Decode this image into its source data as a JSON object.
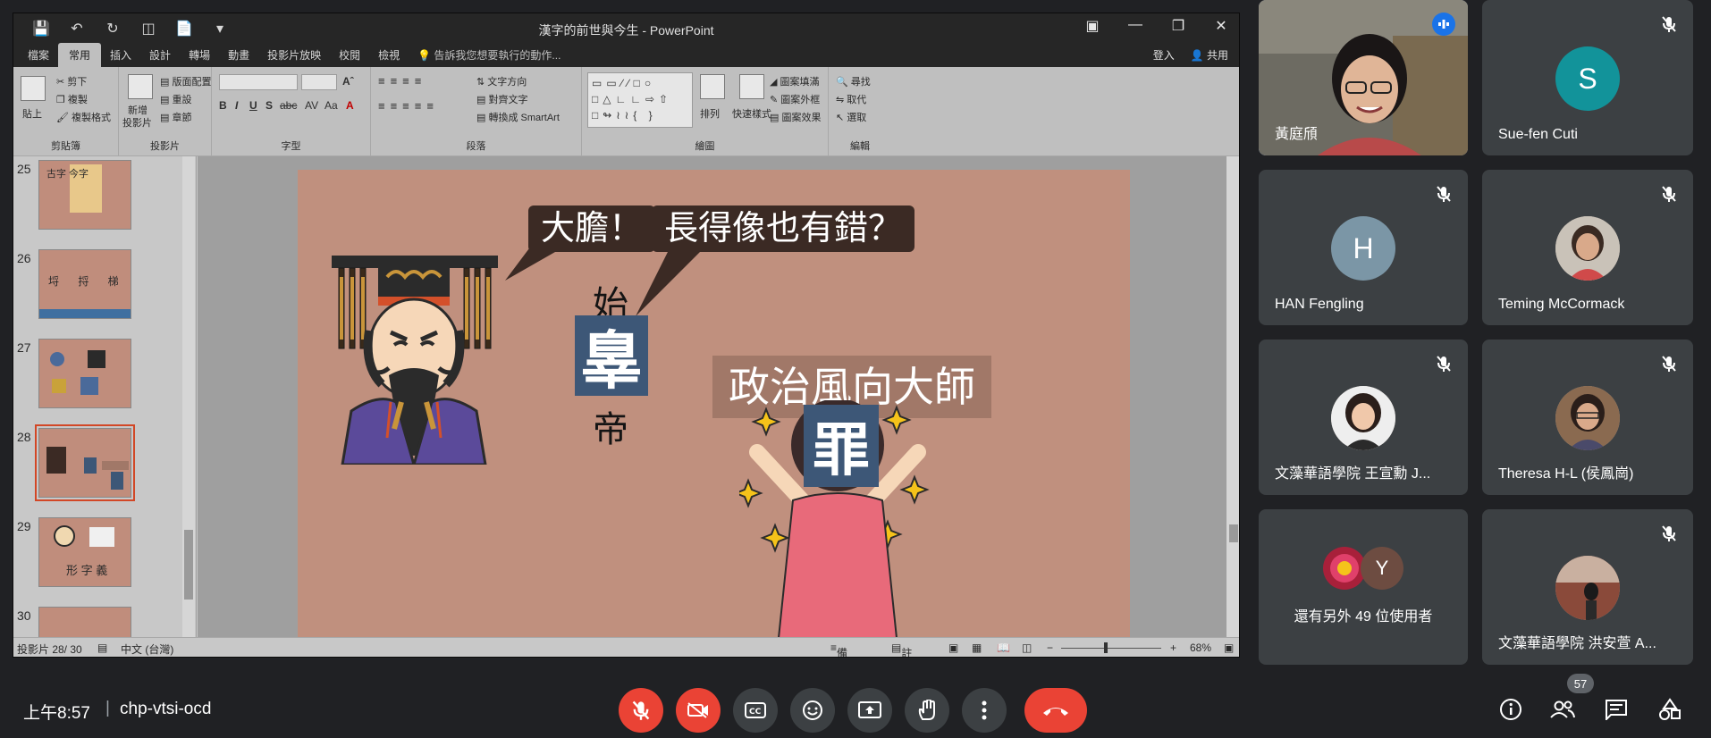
{
  "ppt": {
    "title": "漢字的前世與今生 - PowerPoint",
    "tabs": [
      "檔案",
      "常用",
      "插入",
      "設計",
      "轉場",
      "動畫",
      "投影片放映",
      "校閱",
      "檢視"
    ],
    "tell_me": "告訴我您想要執行的動作...",
    "sign_in": "登入",
    "share": "共用",
    "ribbon": {
      "clipboard": {
        "label": "剪貼簿",
        "paste": "貼上",
        "cut": "剪下",
        "copy": "複製",
        "format_painter": "複製格式"
      },
      "slides": {
        "label": "投影片",
        "new_slide": "新增",
        "new_slide2": "投影片",
        "layout": "版面配置",
        "reset": "重設",
        "section": "章節"
      },
      "font": {
        "label": "字型",
        "bold": "B",
        "italic": "I",
        "underline": "U",
        "strike": "S",
        "abc": "abc",
        "spacing": "AV",
        "case": "Aa",
        "color": "A"
      },
      "paragraph": {
        "label": "段落",
        "text_direction": "文字方向",
        "align_text": "對齊文字",
        "smartart": "轉換成 SmartArt"
      },
      "drawing": {
        "label": "繪圖",
        "arrange": "排列",
        "quick_styles": "快速樣式",
        "fill": "圖案填滿",
        "outline": "圖案外框",
        "effects": "圖案效果"
      },
      "editing": {
        "label": "編輯",
        "find": "尋找",
        "replace": "取代",
        "select": "選取"
      }
    },
    "thumbs": [
      {
        "num": "25",
        "label": "古字 今字"
      },
      {
        "num": "26",
        "label": "埒 捋 梯"
      },
      {
        "num": "27",
        "label": ""
      },
      {
        "num": "28",
        "label": ""
      },
      {
        "num": "29",
        "label": "形 字 義"
      },
      {
        "num": "30",
        "label": ""
      }
    ],
    "slide": {
      "bubble1": "大膽！",
      "bubble2": "長得像也有錯？",
      "shi": "始",
      "zui_old": "辠",
      "di": "帝",
      "banner": "政治風向大師",
      "zui_new": "罪"
    },
    "status": {
      "slide_info": "投影片 28/ 30",
      "language": "中文 (台灣)",
      "notes": "備忘稿",
      "comments": "註解",
      "zoom": "68%"
    },
    "colors": {
      "slide_bg": "#c0907e",
      "bubble": "#3b2a24",
      "blue_box": "#3d5777"
    }
  },
  "participants": [
    {
      "name": "黃庭頎",
      "type": "video",
      "speaking": true
    },
    {
      "name": "Sue-fen Cuti",
      "initial": "S",
      "color": "#12939a"
    },
    {
      "name": "HAN Fengling",
      "initial": "H",
      "color": "#7b96a6"
    },
    {
      "name": "Teming McCormack",
      "type": "photo"
    },
    {
      "name": "文藻華語學院 王宣勳 J...",
      "type": "photo"
    },
    {
      "name": "Theresa H-L (侯鳳崗)",
      "type": "photo"
    },
    {
      "name": "還有另外 49 位使用者",
      "initial": "Y",
      "color": "#6d4c41"
    },
    {
      "name": "文藻華語學院 洪安萱 A...",
      "type": "photo"
    }
  ],
  "bottom_bar": {
    "time": "上午8:57",
    "separator": "|",
    "meeting_code": "chp-vtsi-ocd",
    "participant_count": "57",
    "controls": [
      "mic-off-icon",
      "camera-off-icon",
      "captions-icon",
      "emoji-icon",
      "present-icon",
      "raise-hand-icon",
      "more-icon",
      "end-call-icon"
    ]
  }
}
